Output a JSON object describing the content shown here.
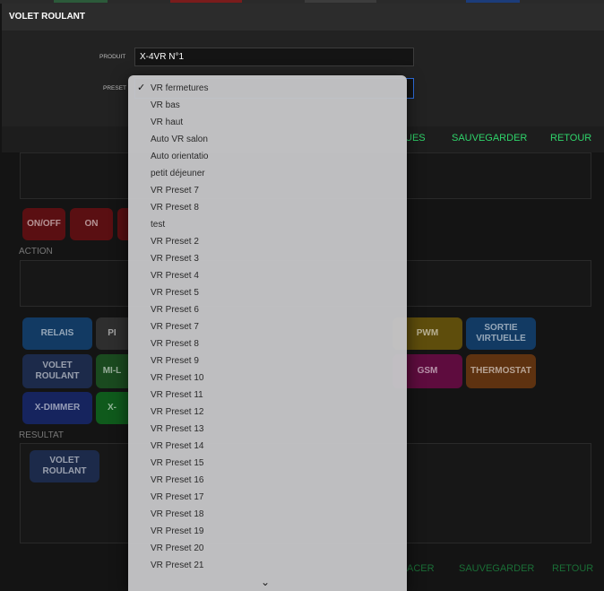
{
  "window": {
    "title": "VOLET ROULANT"
  },
  "form": {
    "product_label": "PRODUIT",
    "product_value": "X-4VR N°1",
    "preset_label": "PRESET"
  },
  "toolbar": {
    "partial_label": "UES",
    "save_label": "SAUVEGARDER",
    "back_label": "RETOUR"
  },
  "sections": {
    "action_label": "ACTION",
    "result_label": "RESULTAT"
  },
  "buttons": {
    "onoff": "ON/OFF",
    "on": "ON",
    "relais": "RELAIS",
    "p_partial": "PI",
    "pwm": "PWM",
    "sortie_virtuelle": "SORTIE VIRTUELLE",
    "volet_roulant": "VOLET ROULANT",
    "mi_partial": "MI-L",
    "gsm": "GSM",
    "thermostat": "THERMOSTAT",
    "x_dimmer": "X-DIMMER",
    "x_partial": "X-",
    "result_volet": "VOLET ROULANT"
  },
  "bottombar": {
    "partial_label": "ACER",
    "save_label": "SAUVEGARDER",
    "back_label": "RETOUR"
  },
  "dropdown": {
    "selected_index": 0,
    "options": [
      "VR fermetures",
      "VR bas",
      "VR haut",
      "Auto VR salon",
      "Auto orientatio",
      "petit déjeuner",
      "VR Preset 7",
      "VR Preset 8",
      "test",
      "VR Preset 2",
      "VR Preset 3",
      "VR Preset 4",
      "VR Preset 5",
      "VR Preset 6",
      "VR Preset 7",
      "VR Preset 8",
      "VR Preset 9",
      "VR Preset 10",
      "VR Preset 11",
      "VR Preset 12",
      "VR Preset 13",
      "VR Preset 14",
      "VR Preset 15",
      "VR Preset 16",
      "VR Preset 17",
      "VR Preset 18",
      "VR Preset 19",
      "VR Preset 20",
      "VR Preset 21"
    ]
  },
  "icons": {
    "check": "checkmark-icon",
    "more": "chevron-down-icon"
  },
  "colors": {
    "accent_green": "#2fd46a",
    "focus_blue": "#2f6fe0",
    "red": "#b3141c",
    "blue": "#1c5ea8",
    "yellow": "#a88a14",
    "magenta": "#a8146e",
    "orange": "#a8581c",
    "green": "#1c7a2a"
  }
}
